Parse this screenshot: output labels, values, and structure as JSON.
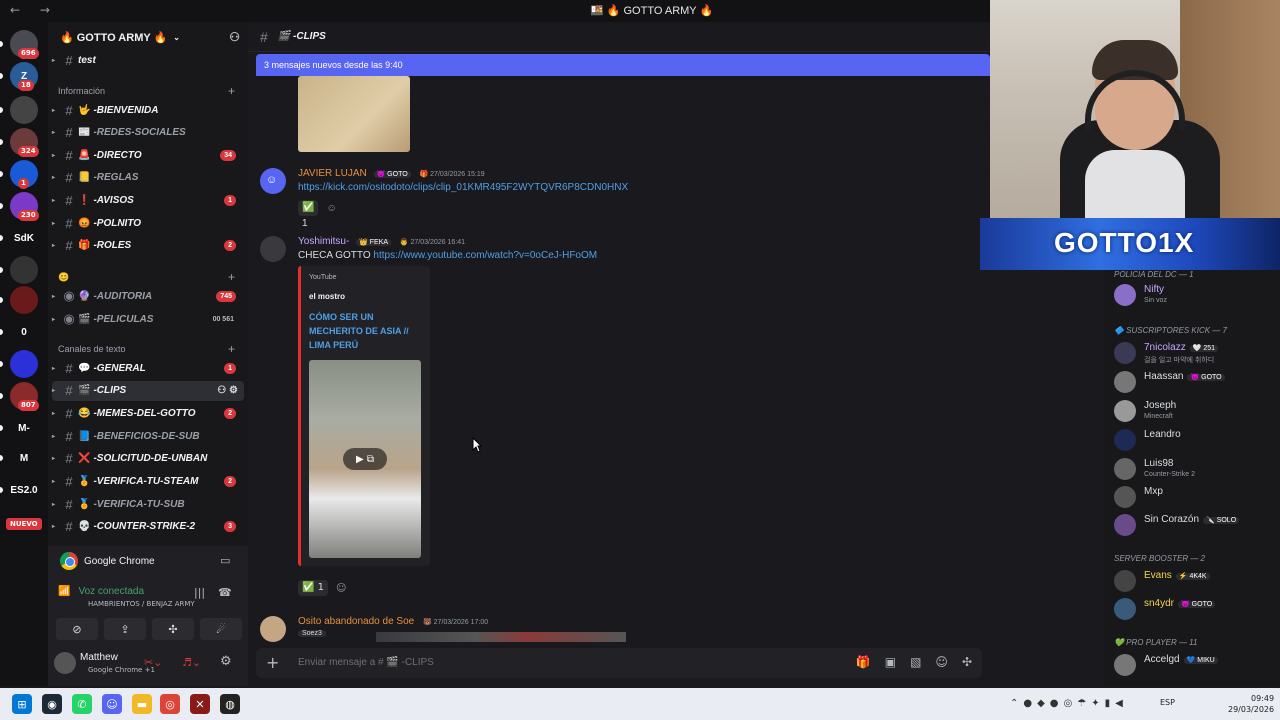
{
  "window": {
    "title": "🍱 🔥 GOTTO ARMY 🔥",
    "nav": "← →"
  },
  "rail": {
    "servers": [
      {
        "label": "",
        "badge": "696",
        "color": "#4a4a52"
      },
      {
        "label": "Z",
        "badge": "18",
        "color": "#2a5c9a"
      },
      {
        "label": "",
        "badge": "",
        "color": "#444"
      },
      {
        "label": "",
        "badge": "324",
        "color": "#6b3a3a"
      },
      {
        "label": "",
        "badge": "1",
        "color": "#1a5ad6"
      },
      {
        "label": "",
        "badge": "230",
        "color": "#7a3ac6"
      },
      {
        "label": "SdK",
        "badge": "",
        "color": "#121214"
      },
      {
        "label": "",
        "badge": "",
        "color": "#333"
      },
      {
        "label": "",
        "badge": "",
        "color": "#6a1a1a"
      },
      {
        "label": "0",
        "badge": "",
        "color": "#121214"
      },
      {
        "label": "",
        "badge": "",
        "color": "#2b30d8"
      },
      {
        "label": "",
        "badge": "807",
        "color": "#8a2a2a"
      },
      {
        "label": "M-",
        "badge": "",
        "color": "#121214"
      },
      {
        "label": "M",
        "badge": "",
        "color": "#121214"
      },
      {
        "label": "ES2.0",
        "badge": "",
        "color": "#121214"
      }
    ],
    "nuevo": "NUEVO"
  },
  "server": {
    "name": "🔥 GOTTO ARMY 🔥",
    "channels_top": [
      {
        "name": "test"
      }
    ],
    "cat_info": "Información",
    "info_channels": [
      {
        "emoji": "🤟",
        "name": "-BIENVENIDA",
        "unread": true,
        "count": ""
      },
      {
        "emoji": "📰",
        "name": "-REDES-SOCIALES",
        "unread": false,
        "count": ""
      },
      {
        "emoji": "🚨",
        "name": "-DIRECTO",
        "unread": true,
        "count": "34"
      },
      {
        "emoji": "📒",
        "name": "-REGLAS",
        "unread": false,
        "count": ""
      },
      {
        "emoji": "❗",
        "name": "-AVISOS",
        "unread": true,
        "count": "1"
      },
      {
        "emoji": "😡",
        "name": "-POLNITO",
        "unread": true,
        "count": ""
      },
      {
        "emoji": "🎁",
        "name": "-ROLES",
        "unread": true,
        "count": "2"
      }
    ],
    "cat_emoji": "😊",
    "voice_channels": [
      {
        "emoji": "🔮",
        "name": "-AUDITORIA",
        "count": "745",
        "extra": ""
      },
      {
        "emoji": "🎬",
        "name": "-PELICULAS",
        "count": "",
        "extra": "00 561"
      }
    ],
    "cat_text": "Canales de texto",
    "text_channels": [
      {
        "emoji": "💬",
        "name": "-GENERAL",
        "unread": true,
        "count": "1",
        "active": false
      },
      {
        "emoji": "🎬",
        "name": "-CLIPS",
        "unread": true,
        "count": "",
        "active": true
      },
      {
        "emoji": "😂",
        "name": "-MEMES-DEL-GOTTO",
        "unread": true,
        "count": "2",
        "active": false
      },
      {
        "emoji": "📘",
        "name": "-BENEFICIOS-DE-SUB",
        "unread": false,
        "count": "",
        "active": false
      },
      {
        "emoji": "❌",
        "name": "-SOLICITUD-DE-UNBAN",
        "unread": true,
        "count": "",
        "active": false
      },
      {
        "emoji": "🏅",
        "name": "-VERIFICA-TU-STEAM",
        "unread": true,
        "count": "2",
        "active": false
      },
      {
        "emoji": "🏅",
        "name": "-VERIFICA-TU-SUB",
        "unread": false,
        "count": "",
        "active": false
      },
      {
        "emoji": "💀",
        "name": "-COUNTER-STRIKE-2",
        "unread": true,
        "count": "3",
        "active": false
      }
    ]
  },
  "voice": {
    "app": "Google Chrome",
    "status": "Voz conectada",
    "location": "HAMBRIENTOS / BENJAZ ARMY",
    "user": "Matthew",
    "user_sub": "Google Chrome +1"
  },
  "chat": {
    "channel": "🎬 -CLIPS",
    "new_bar": "3 mensajes nuevos desde las 9:40",
    "messages": [
      {
        "author": "JAVIER LUJAN",
        "author_color": "#e8903a",
        "tag": "😈 GOTO",
        "time": "🎁 27/03/2026 15:19",
        "text": "",
        "link": "https://kick.com/ositodoto/clips/clip_01KMR495F2WYTQVR6P8CDN0HNX",
        "react": "1"
      },
      {
        "author": "Yoshimitsu-",
        "author_color": "#c9a6ff",
        "tag": "👑 FEKA",
        "time": "👨 27/03/2026 16:41",
        "text": "CHECA GOTTO",
        "link": "https://www.youtube.com/watch?v=0oCeJ-HFoOM",
        "react": "1"
      },
      {
        "author": "Osito abandonado de Soe",
        "author_color": "#e8903a",
        "tag": "",
        "time": "🐻 27/03/2026 17:00",
        "text": "Soez3",
        "link": "",
        "react": ""
      }
    ],
    "embed": {
      "provider": "YouTube",
      "author": "el mostro",
      "title": "CÓMO SER UN MECHERITO DE ASIA // LIMA PERÚ"
    },
    "composer_placeholder": "Enviar mensaje a # 🎬 -CLIPS"
  },
  "stream": {
    "overlay_name": "GOTTO1X"
  },
  "members": {
    "categories": [
      {
        "label": "POLICIA DEL DC — 1"
      },
      {
        "label": "🔷 SUSCRIPTORES KICK — 7"
      },
      {
        "label": "SERVER BOOSTER — 2"
      },
      {
        "label": "💚 PRO PLAYER — 11"
      }
    ],
    "list": [
      {
        "name": "Nifty",
        "sub": "Sin voz",
        "color": "#c9a6ff",
        "tag": ""
      },
      {
        "name": "7nicolazz",
        "sub": "걸을 일고 마약에 취하디",
        "color": "#c9a6ff",
        "tag": "🤍 251"
      },
      {
        "name": "Haassan",
        "sub": "",
        "color": "#dbdee1",
        "tag": "😈 GOTO"
      },
      {
        "name": "Joseph",
        "sub": "Minecraft",
        "color": "#dbdee1",
        "tag": ""
      },
      {
        "name": "Leandro",
        "sub": "",
        "color": "#dbdee1",
        "tag": ""
      },
      {
        "name": "Luis98",
        "sub": "Counter-Strike 2",
        "color": "#dbdee1",
        "tag": ""
      },
      {
        "name": "Mxp",
        "sub": "",
        "color": "#dbdee1",
        "tag": ""
      },
      {
        "name": "Sin Corazón",
        "sub": "",
        "color": "#dbdee1",
        "tag": "🔪 SOLO"
      },
      {
        "name": "Evans",
        "sub": "",
        "color": "#f4d34a",
        "tag": "⚡ 4K4K"
      },
      {
        "name": "sn4ydr",
        "sub": "",
        "color": "#f4d34a",
        "tag": "😈 GOTO"
      },
      {
        "name": "Accelgd",
        "sub": "",
        "color": "#dbdee1",
        "tag": "💙 MIKU"
      }
    ]
  },
  "taskbar": {
    "lang": "ESP",
    "time": "09:49",
    "date": "29/03/2026"
  }
}
